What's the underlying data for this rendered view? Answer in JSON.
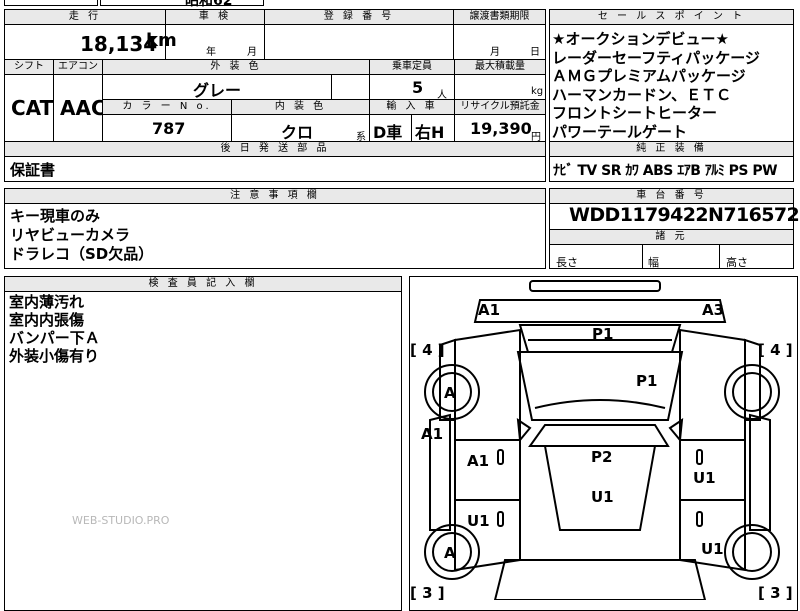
{
  "top_strip": {
    "cut_text": "昭和62"
  },
  "headers": {
    "mileage": "走 行",
    "inspection": "車 検",
    "registration": "登 録 番 号",
    "transfer": "譲渡書類期限",
    "sales_points": "セ ー ル ス ポ イ ン ト",
    "shift": "シフト",
    "aircon": "エアコン",
    "exterior_color": "外 装 色",
    "capacity": "乗車定員",
    "max_load": "最大積載量",
    "color_no": "カ ラ ー N o.",
    "interior_color": "内 装 色",
    "import_car": "輸 入 車",
    "recycle_fee": "リサイクル預託金",
    "after_ship": "後 日 発 送 部 品",
    "genuine_equipment": "純 正 装 備",
    "notes": "注 意 事 項 欄",
    "chassis_no": "車 台 番 号",
    "dimensions": "諸 元",
    "inspector_notes": "検 査 員 記 入 欄"
  },
  "mileage": {
    "value": "18,134",
    "unit": "km"
  },
  "inspection": {
    "year_unit": "年",
    "month_unit": "月"
  },
  "transfer": {
    "month_unit": "月",
    "day_unit": "日"
  },
  "sales_points": [
    "★オークションデビュー★",
    "レーダーセーフティパッケージ",
    "ＡＭＧプレミアムパッケージ",
    "ハーマンカードン、ＥＴＣ",
    "フロントシートヒーター",
    "パワーテールゲート"
  ],
  "shift": "CAT",
  "aircon": "AAC",
  "exterior_color": "グレー",
  "capacity": {
    "value": "5",
    "unit": "人"
  },
  "max_load": {
    "unit": "kg"
  },
  "color_no": "787",
  "interior_color": {
    "value": "クロ",
    "suffix": "系"
  },
  "import_car": {
    "type": "D車",
    "steering": "右H"
  },
  "recycle_fee": {
    "value": "19,390",
    "unit": "円"
  },
  "after_ship": "保証書",
  "genuine_equipment": "ﾅﾋﾞ TV SR ｶﾜ ABS ｴｱB ｱﾙﾐ PS PW",
  "notes": [
    "キー現車のみ",
    "リヤビューカメラ",
    "ドラレコ（SD欠品）"
  ],
  "chassis_no": "WDD1179422N716572",
  "dimensions": {
    "length": "長さ",
    "width": "幅",
    "height": "高さ"
  },
  "inspector_notes": [
    "室内薄汚れ",
    "室内内張傷",
    "バンパー下Ａ",
    "外装小傷有り"
  ],
  "watermark": "WEB-STUDIO.PRO",
  "diagram": {
    "marks": [
      "A1",
      "A3",
      "P1",
      "P1",
      "A",
      "A1",
      "A1",
      "P2",
      "U1",
      "U1",
      "U1",
      "A",
      "U1"
    ],
    "panel_numbers": [
      "[ 4 ]",
      "[ 4 ]",
      "[ 3 ]",
      "[ 3 ]"
    ]
  }
}
